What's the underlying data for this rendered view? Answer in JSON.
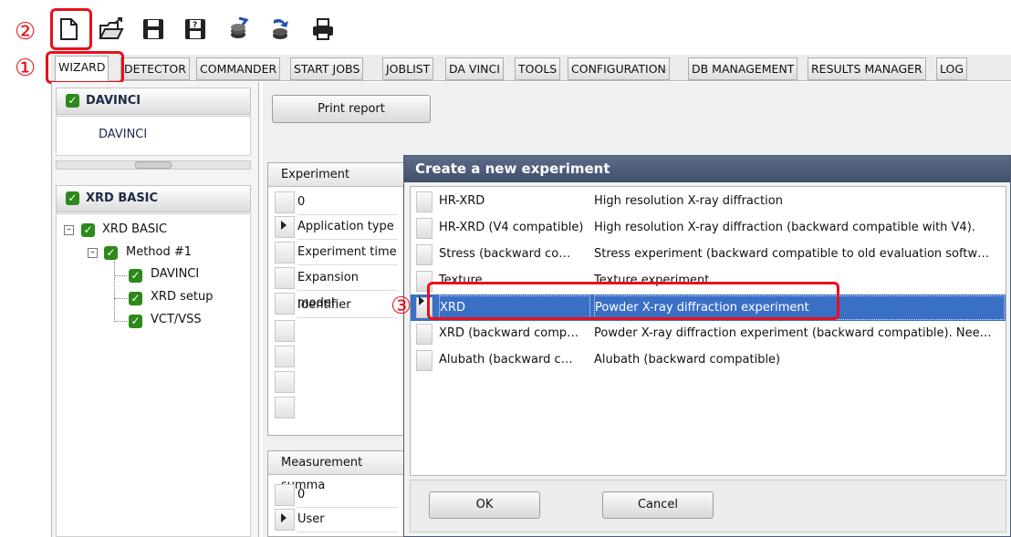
{
  "annotations": {
    "m1": "①",
    "m2": "②",
    "m3": "③"
  },
  "toolbar": {
    "icons": [
      "new-document-icon",
      "open-folder-icon",
      "save-icon",
      "save-as-icon",
      "import-icon",
      "export-icon",
      "print-icon"
    ]
  },
  "tabs": [
    "WIZARD",
    "DETECTOR",
    "COMMANDER",
    "START JOBS",
    "JOBLIST",
    "DA VINCI",
    "TOOLS",
    "CONFIGURATION",
    "DB MANAGEMENT",
    "RESULTS MANAGER",
    "LOG"
  ],
  "left": {
    "group1": {
      "title": "DAVINCI",
      "item": "DAVINCI"
    },
    "collapse_label": "•••",
    "group2": {
      "title": "XRD BASIC"
    },
    "tree": {
      "root": "XRD BASIC",
      "method": "Method #1",
      "children": [
        "DAVINCI",
        "XRD setup",
        "VCT/VSS"
      ]
    }
  },
  "main": {
    "print_report": "Print report",
    "experiment": {
      "header": "Experiment",
      "index": "0",
      "rows": [
        "Application type",
        "Experiment time",
        "Expansion model",
        "Identifier"
      ]
    },
    "measurement": {
      "header": "Measurement summa",
      "index": "0",
      "rows": [
        "User"
      ]
    }
  },
  "dialog": {
    "title": "Create a new experiment",
    "items": [
      {
        "name": "HR-XRD",
        "desc": "High resolution X-ray diffraction"
      },
      {
        "name": "HR-XRD (V4 compatible)",
        "desc": "High resolution X-ray diffraction (backward compatible with V4)."
      },
      {
        "name": "Stress (backward co…",
        "desc": "Stress experiment (backward compatible to old evaluation softw…"
      },
      {
        "name": "Texture",
        "desc": "Texture experiment"
      },
      {
        "name": "XRD",
        "desc": "Powder X-ray diffraction experiment"
      },
      {
        "name": "XRD (backward comp…",
        "desc": "Powder X-ray diffraction experiment (backward compatible). Nee…"
      },
      {
        "name": "Alubath (backward c…",
        "desc": "Alubath (backward compatible)"
      }
    ],
    "selected_index": 4,
    "ok": "OK",
    "cancel": "Cancel"
  },
  "colors": {
    "annotation": "#e8101c",
    "selection": "#3a6fc6",
    "title_bar": "#4a5a77"
  }
}
